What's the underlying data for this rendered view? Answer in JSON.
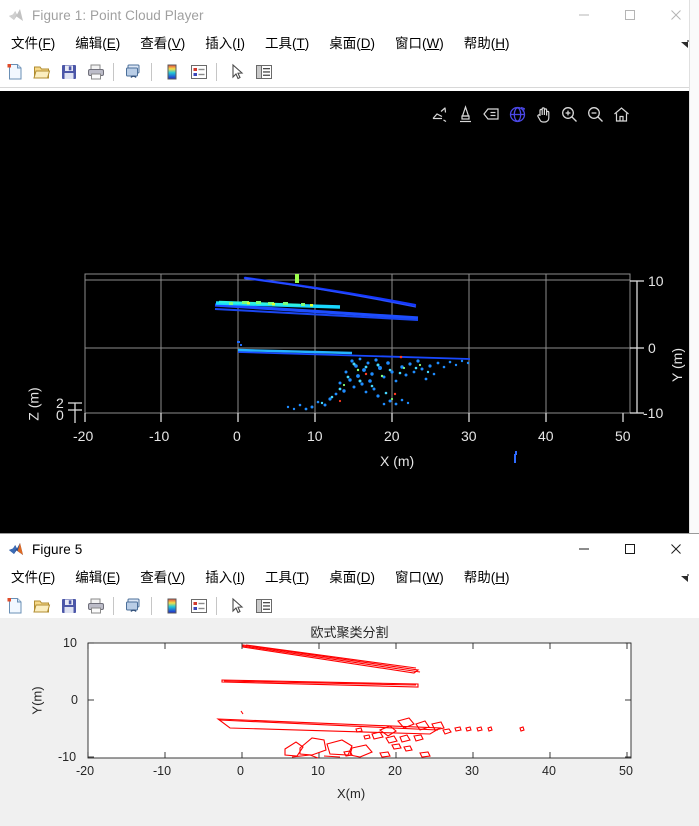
{
  "figure1": {
    "title": "Figure 1: Point Cloud Player",
    "app_icon": "matlab-icon",
    "active": false,
    "window_controls": [
      {
        "name": "minimize-button",
        "glyph": "minimize-icon"
      },
      {
        "name": "maximize-button",
        "glyph": "maximize-icon"
      },
      {
        "name": "close-button",
        "glyph": "close-icon"
      }
    ],
    "menu": [
      {
        "label": "文件(F)",
        "pre": "文件(",
        "key": "F",
        "post": ")"
      },
      {
        "label": "编辑(E)",
        "pre": "编辑(",
        "key": "E",
        "post": ")"
      },
      {
        "label": "查看(V)",
        "pre": "查看(",
        "key": "V",
        "post": ")"
      },
      {
        "label": "插入(I)",
        "pre": "插入(",
        "key": "I",
        "post": ")"
      },
      {
        "label": "工具(T)",
        "pre": "工具(",
        "key": "T",
        "post": ")"
      },
      {
        "label": "桌面(D)",
        "pre": "桌面(",
        "key": "D",
        "post": ")"
      },
      {
        "label": "窗口(W)",
        "pre": "窗口(",
        "key": "W",
        "post": ")"
      },
      {
        "label": "帮助(H)",
        "pre": "帮助(",
        "key": "H",
        "post": ")"
      }
    ],
    "toolbar": [
      {
        "name": "new-figure-button",
        "icon": "new-document-icon"
      },
      {
        "name": "open-file-button",
        "icon": "open-folder-icon"
      },
      {
        "name": "save-figure-button",
        "icon": "save-disk-icon"
      },
      {
        "name": "print-figure-button",
        "icon": "printer-icon"
      },
      {
        "name": "link-plot-button",
        "icon": "link-plot-icon"
      },
      {
        "name": "colorbar-button",
        "icon": "colorbar-icon"
      },
      {
        "name": "legend-button",
        "icon": "legend-icon"
      },
      {
        "name": "edit-plot-button",
        "icon": "arrow-pointer-icon"
      },
      {
        "name": "plot-browser-button",
        "icon": "plot-browser-icon"
      }
    ],
    "axes_toolbar": [
      {
        "name": "export-button",
        "icon": "export-icon",
        "active": false
      },
      {
        "name": "brush-data-button",
        "icon": "brush-icon",
        "active": false
      },
      {
        "name": "data-tips-button",
        "icon": "data-tip-icon",
        "active": false
      },
      {
        "name": "rotate-3d-button",
        "icon": "rotate-3d-icon",
        "active": true
      },
      {
        "name": "pan-button",
        "icon": "pan-hand-icon",
        "active": false
      },
      {
        "name": "zoom-in-button",
        "icon": "zoom-in-icon",
        "active": false
      },
      {
        "name": "zoom-out-button",
        "icon": "zoom-out-icon",
        "active": false
      },
      {
        "name": "restore-view-button",
        "icon": "home-icon",
        "active": false
      }
    ]
  },
  "figure5": {
    "title": "Figure 5",
    "app_icon": "matlab-icon",
    "active": true,
    "window_controls": [
      {
        "name": "minimize-button",
        "glyph": "minimize-icon"
      },
      {
        "name": "maximize-button",
        "glyph": "maximize-icon"
      },
      {
        "name": "close-button",
        "glyph": "close-icon"
      }
    ],
    "menu": [
      {
        "label": "文件(F)",
        "pre": "文件(",
        "key": "F",
        "post": ")"
      },
      {
        "label": "编辑(E)",
        "pre": "编辑(",
        "key": "E",
        "post": ")"
      },
      {
        "label": "查看(V)",
        "pre": "查看(",
        "key": "V",
        "post": ")"
      },
      {
        "label": "插入(I)",
        "pre": "插入(",
        "key": "I",
        "post": ")"
      },
      {
        "label": "工具(T)",
        "pre": "工具(",
        "key": "T",
        "post": ")"
      },
      {
        "label": "桌面(D)",
        "pre": "桌面(",
        "key": "D",
        "post": ")"
      },
      {
        "label": "窗口(W)",
        "pre": "窗口(",
        "key": "W",
        "post": ")"
      },
      {
        "label": "帮助(H)",
        "pre": "帮助(",
        "key": "H",
        "post": ")"
      }
    ],
    "toolbar": [
      {
        "name": "new-figure-button",
        "icon": "new-document-icon"
      },
      {
        "name": "open-file-button",
        "icon": "open-folder-icon"
      },
      {
        "name": "save-figure-button",
        "icon": "save-disk-icon"
      },
      {
        "name": "print-figure-button",
        "icon": "printer-icon"
      },
      {
        "name": "link-plot-button",
        "icon": "link-plot-icon"
      },
      {
        "name": "colorbar-button",
        "icon": "colorbar-icon"
      },
      {
        "name": "legend-button",
        "icon": "legend-icon"
      },
      {
        "name": "edit-plot-button",
        "icon": "arrow-pointer-icon"
      },
      {
        "name": "plot-browser-button",
        "icon": "plot-browser-icon"
      }
    ]
  },
  "chart_data": [
    {
      "id": "point-cloud-scatter",
      "type": "scatter",
      "title": "",
      "xlabel": "X (m)",
      "ylabel": "Y (m)",
      "zlabel": "Z (m)",
      "xticks": [
        "-20",
        "-10",
        "0",
        "10",
        "20",
        "30",
        "40",
        "50"
      ],
      "xtickvals": [
        -20,
        -10,
        0,
        10,
        20,
        30,
        40,
        50
      ],
      "yticks": [
        "10",
        "0",
        "-10"
      ],
      "ytickvals": [
        10,
        0,
        -10
      ],
      "zticks": [
        "2",
        "0"
      ],
      "ztickvals": [
        2,
        0
      ],
      "xlim": [
        -25,
        55
      ],
      "ylim": [
        -15,
        15
      ],
      "grid": true,
      "background": "#000000",
      "axis_color": "#e6e6e6",
      "colormap": [
        "#0000ff",
        "#0055ff",
        "#00aaff",
        "#00ffe0",
        "#55ff88",
        "#d4ff33",
        "#ff3300"
      ],
      "clusters": [
        {
          "name": "wall-line-upper",
          "x_range": [
            -3,
            22
          ],
          "y_range": [
            7.5,
            9.5
          ],
          "color": "#1040ff"
        },
        {
          "name": "wall-line-middle",
          "x_range": [
            -4,
            22
          ],
          "y_range": [
            5.5,
            7.0
          ],
          "color": "#22e0ff"
        },
        {
          "name": "ground-line",
          "x_range": [
            0,
            30
          ],
          "y_range": [
            -1.0,
            -0.5
          ],
          "color": "#1155ff"
        },
        {
          "name": "vehicle-cluster-a",
          "x_range": [
            5,
            14
          ],
          "y_range": [
            -6.5,
            -3.0
          ],
          "color": "#1e90ff"
        },
        {
          "name": "vehicle-cluster-b",
          "x_range": [
            11,
            22
          ],
          "y_range": [
            -6.0,
            -1.5
          ],
          "color": "#1e90ff"
        },
        {
          "name": "far-object",
          "x_range": [
            35.5,
            36.5
          ],
          "y_range": [
            -2.5,
            -1.0
          ],
          "color": "#2f6bff"
        },
        {
          "name": "green-marker",
          "x_range": [
            7,
            7.6
          ],
          "y_range": [
            8.4,
            9.4
          ],
          "color": "#8cff4d"
        }
      ]
    },
    {
      "id": "euclidean-cluster-contours",
      "type": "line",
      "title": "欧式聚类分割",
      "xlabel": "X(m)",
      "ylabel": "Y(m)",
      "xticks": [
        "-20",
        "-10",
        "0",
        "10",
        "20",
        "30",
        "40",
        "50"
      ],
      "xtickvals": [
        -20,
        -10,
        0,
        10,
        20,
        30,
        40,
        50
      ],
      "yticks": [
        "10",
        "0",
        "-10"
      ],
      "ytickvals": [
        10,
        0,
        -10
      ],
      "xlim": [
        -25,
        55
      ],
      "ylim": [
        -10,
        10
      ],
      "grid": false,
      "background": "#ffffff",
      "line_color": "#ff0000",
      "contours": [
        {
          "name": "roof-sliver-upper",
          "x_range": [
            0,
            22
          ],
          "y_range": [
            6.0,
            10.0
          ]
        },
        {
          "name": "roof-sliver-lower",
          "x_range": [
            -3,
            22
          ],
          "y_range": [
            5.0,
            6.2
          ]
        },
        {
          "name": "ground-wedge",
          "x_range": [
            -3,
            30
          ],
          "y_range": [
            -4.0,
            -2.6
          ]
        },
        {
          "name": "vehicle-blob-cluster",
          "x_range": [
            5,
            22
          ],
          "y_range": [
            -10.0,
            -3.0
          ]
        },
        {
          "name": "speckle-right",
          "x_range": [
            20,
            30
          ],
          "y_range": [
            -5.0,
            -3.5
          ]
        }
      ]
    }
  ]
}
